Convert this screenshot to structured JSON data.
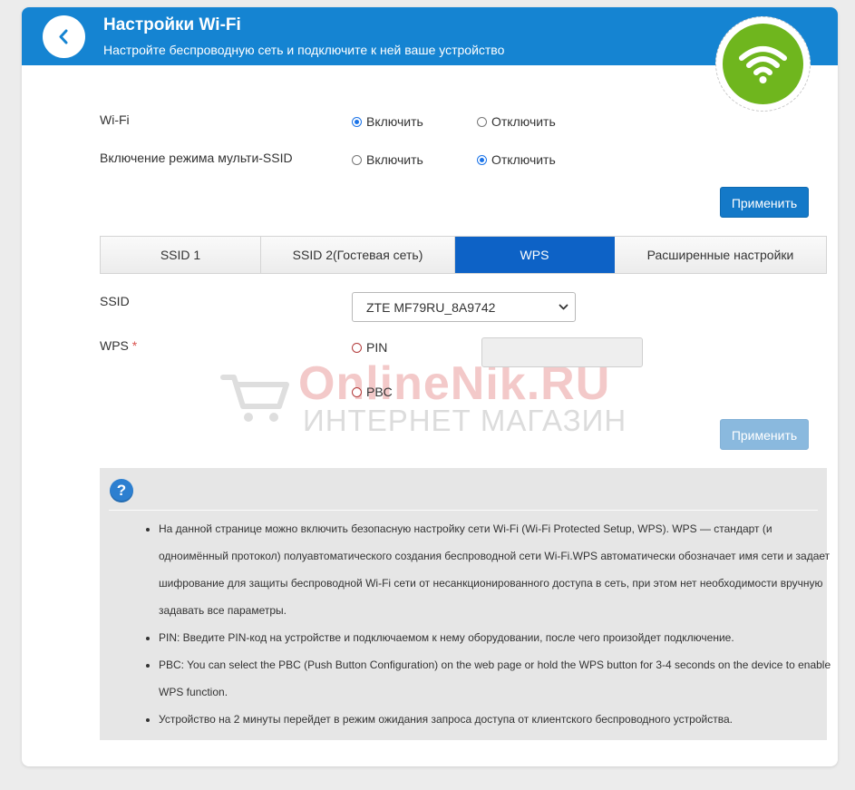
{
  "header": {
    "title": "Настройки Wi-Fi",
    "subtitle": "Настройте беспроводную сеть и подключите к ней ваше устройство",
    "back_icon": "chevron-left-icon",
    "status_icon": "wifi-icon",
    "colors": {
      "bar": "#1584d2",
      "badge": "#6fb61e"
    }
  },
  "wifi_settings": {
    "wifi": {
      "label": "Wi-Fi",
      "options": [
        "Включить",
        "Отключить"
      ],
      "selected": "Включить"
    },
    "multi_ssid": {
      "label": "Включение режима мульти-SSID",
      "options": [
        "Включить",
        "Отключить"
      ],
      "selected": "Отключить"
    },
    "apply_label": "Применить"
  },
  "tabs": {
    "items": [
      "SSID 1",
      "SSID 2(Гостевая сеть)",
      "WPS",
      "Расширенные настройки"
    ],
    "active": "WPS"
  },
  "wps": {
    "ssid_label": "SSID",
    "ssid_value": "ZTE MF79RU_8A9742",
    "wps_label": "WPS",
    "required_mark": "*",
    "options": [
      "PIN",
      "PBC"
    ],
    "pin_value": "",
    "apply_label": "Применить",
    "apply_disabled": true
  },
  "watermark": {
    "line1": "OnlineNik.RU",
    "line2": "ИНТЕРНЕТ МАГАЗИН"
  },
  "help": {
    "icon_text": "?",
    "items": [
      "На данной странице можно включить безопасную настройку сети Wi-Fi (Wi-Fi Protected Setup, WPS). WPS — стандарт (и одноимённый протокол) полуавтоматического создания беспроводной сети Wi-Fi.WPS автоматически обозначает имя сети и задает шифрование для защиты беспроводной Wi-Fi сети от несанкционированного доступа в сеть, при этом нет необходимости вручную задавать все параметры.",
      "PIN: Введите PIN-код на устройстве и подключаемом к нему оборудовании, после чего произойдет подключение.",
      "PBC: You can select the PBC (Push Button Configuration) on the web page or hold the WPS button for 3-4 seconds on the device to enable WPS function.",
      "Устройство на 2 минуты перейдет в режим ожидания запроса доступа от клиентского беспроводного устройства."
    ]
  }
}
